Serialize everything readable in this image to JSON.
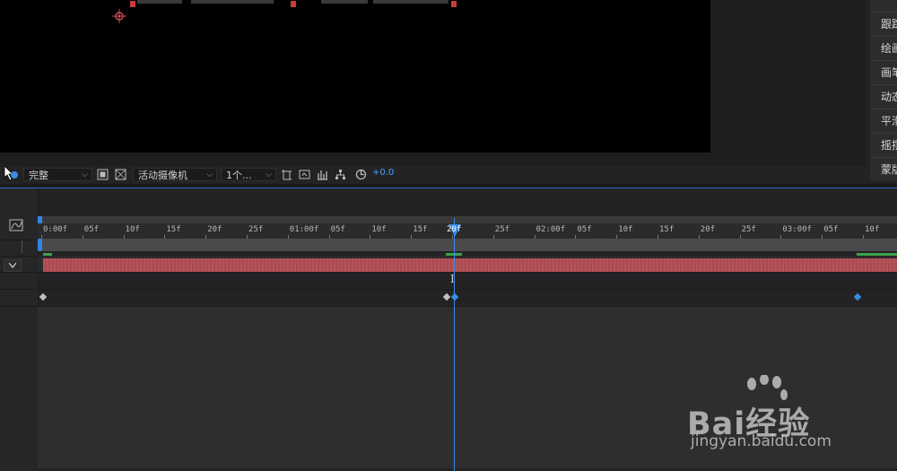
{
  "viewer": {
    "resolution": {
      "value": "完整"
    },
    "camera": {
      "value": "活动摄像机"
    },
    "views": {
      "value": "1个..."
    },
    "exposure_offset": "+0.0"
  },
  "effects_panel": {
    "items": [
      {
        "label": "跟踪"
      },
      {
        "label": "绘画"
      },
      {
        "label": "画笔"
      },
      {
        "label": "动态"
      },
      {
        "label": "平滑"
      },
      {
        "label": "摇摆"
      },
      {
        "label": "蒙版"
      }
    ]
  },
  "timeline": {
    "ruler_labels": [
      "0:00f",
      "05f",
      "10f",
      "15f",
      "20f",
      "25f",
      "01:00f",
      "05f",
      "10f",
      "15f",
      "20f",
      "25f",
      "02:00f",
      "05f",
      "10f",
      "15f",
      "20f",
      "25f",
      "03:00f",
      "05f",
      "10f"
    ],
    "current_time_label": "20f",
    "layer_color": "#b05055",
    "accent_color": "#3a8de6"
  },
  "watermark": {
    "text": "Bai经验",
    "url": "jingyan.baidu.com"
  },
  "icons": [
    "anchor-point-icon",
    "pointer-cursor-icon",
    "region-of-interest-icon",
    "transparency-grid-icon",
    "3d-view-icon",
    "snapshot-icon",
    "show-channel-icon",
    "flowchart-icon",
    "exposure-reset-icon",
    "graph-editor-icon",
    "text-cursor-icon"
  ]
}
